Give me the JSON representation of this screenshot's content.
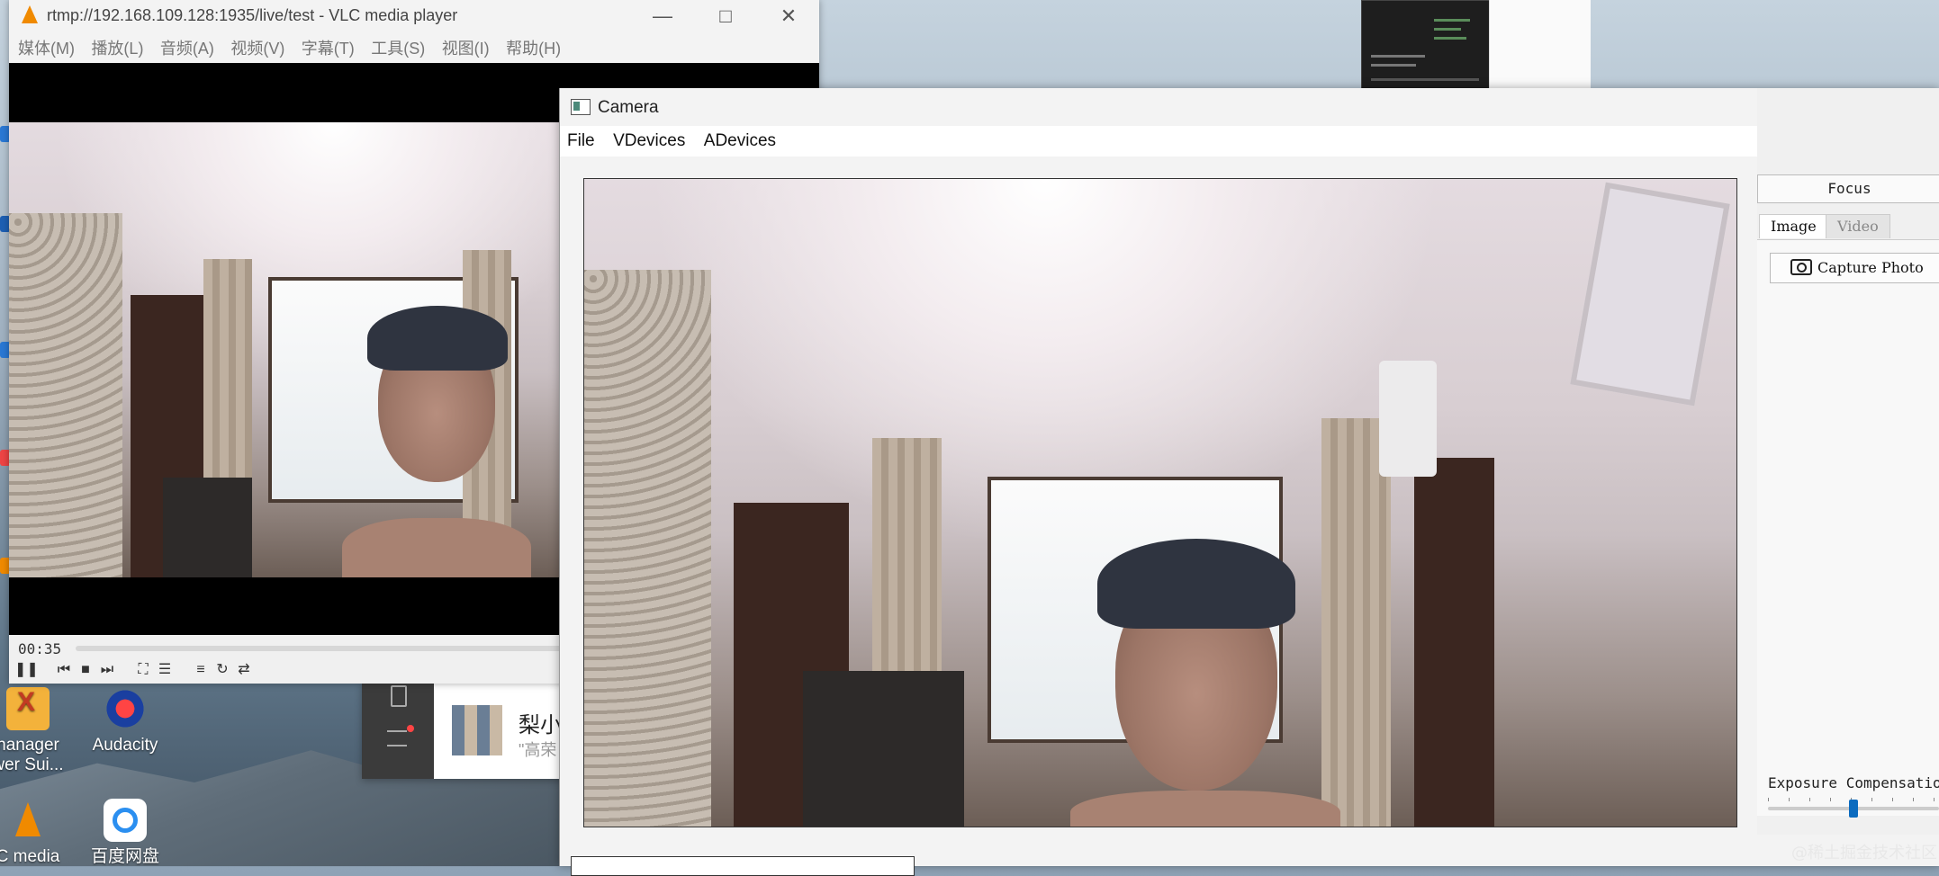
{
  "vlc": {
    "title": "rtmp://192.168.109.128:1935/live/test - VLC media player",
    "menu": [
      "媒体(M)",
      "播放(L)",
      "音频(A)",
      "视频(V)",
      "字幕(T)",
      "工具(S)",
      "视图(I)",
      "帮助(H)"
    ],
    "elapsed": "00:35"
  },
  "camera": {
    "title": "Camera",
    "menu": [
      "File",
      "VDevices",
      "ADevices"
    ],
    "focus_label": "Focus",
    "tabs": [
      "Image",
      "Video"
    ],
    "capture_label": "Capture Photo",
    "exposure_label": "Exposure Compensation",
    "exposure_value_fraction": 0.5
  },
  "desktop": {
    "icons": [
      {
        "label": "nanager\nwer Sui...",
        "icon": "office-x-icon"
      },
      {
        "label": "Audacity",
        "icon": "audacity-icon"
      },
      {
        "label": "C media",
        "icon": "vlc-cone-icon"
      },
      {
        "label": "百度网盘",
        "icon": "baidu-netdisk-icon"
      }
    ],
    "notification": {
      "name": "梨小",
      "sub": "\"高荣"
    }
  },
  "watermark": "@稀土掘金技术社区",
  "colors": {
    "vlc_orange": "#f08a00",
    "slider_blue": "#0b6bbf"
  }
}
